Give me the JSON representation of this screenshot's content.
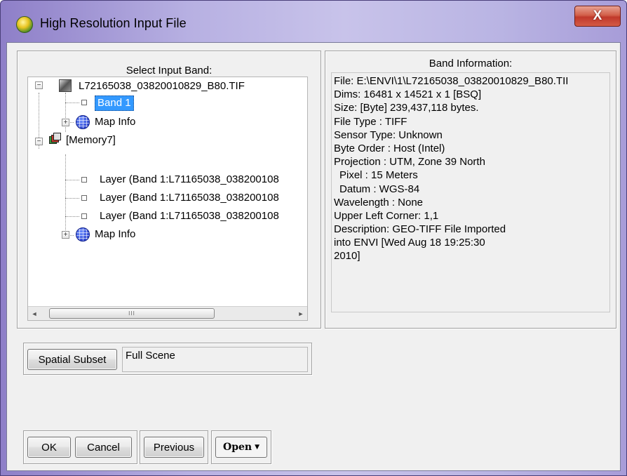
{
  "window": {
    "title": "High Resolution Input File",
    "close_glyph": "X"
  },
  "input_band": {
    "title": "Select Input Band:",
    "tree": {
      "file_name": "L72165038_03820010829_B80.TIF",
      "band": "Band 1",
      "map_info": "Map Info",
      "memory": "[Memory7]",
      "layers": [
        "Layer (Band 1:L71165038_038200108",
        "Layer (Band 1:L71165038_038200108",
        "Layer (Band 1:L71165038_038200108"
      ],
      "memory_map_info": "Map Info"
    },
    "scroll_left": "◄",
    "scroll_right": "►",
    "scroll_grip": "III"
  },
  "band_info": {
    "title": "Band Information:",
    "lines": [
      "File: E:\\ENVI\\1\\L72165038_03820010829_B80.TII",
      "Dims: 16481 x 14521 x 1 [BSQ]",
      "Size: [Byte] 239,437,118 bytes.",
      "File Type  : TIFF",
      "Sensor Type: Unknown",
      "Byte Order : Host (Intel)",
      "Projection : UTM, Zone 39 North",
      "Pixel    : 15 Meters",
      "Datum    : WGS-84",
      "Wavelength : None",
      "Upper Left Corner: 1,1",
      "Description: GEO-TIFF File Imported",
      "into ENVI [Wed Aug 18 19:25:30",
      "2010]"
    ]
  },
  "spatial": {
    "button_label": "Spatial Subset",
    "value": "Full Scene"
  },
  "buttons": {
    "ok": "OK",
    "cancel": "Cancel",
    "previous": "Previous",
    "open": "Open"
  },
  "icons": {
    "app": "envi-globe-icon",
    "file": "image-file-icon",
    "memory": "memory-stack-icon",
    "map": "globe-icon"
  }
}
